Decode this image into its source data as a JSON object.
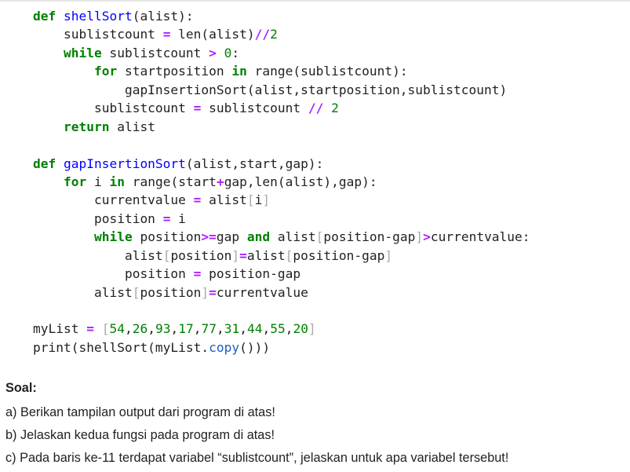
{
  "code": {
    "language": "python",
    "lines": [
      [
        {
          "t": "def ",
          "c": "kw"
        },
        {
          "t": "shellSort",
          "c": "fn"
        },
        {
          "t": "(alist):",
          "c": ""
        }
      ],
      [
        {
          "t": "    sublistcount ",
          "c": ""
        },
        {
          "t": "=",
          "c": "op"
        },
        {
          "t": " len(alist)",
          "c": ""
        },
        {
          "t": "//",
          "c": "op"
        },
        {
          "t": "2",
          "c": "num"
        }
      ],
      [
        {
          "t": "    ",
          "c": ""
        },
        {
          "t": "while",
          "c": "kw"
        },
        {
          "t": " sublistcount ",
          "c": ""
        },
        {
          "t": ">",
          "c": "op"
        },
        {
          "t": " ",
          "c": ""
        },
        {
          "t": "0",
          "c": "num"
        },
        {
          "t": ":",
          "c": ""
        }
      ],
      [
        {
          "t": "        ",
          "c": ""
        },
        {
          "t": "for",
          "c": "kw"
        },
        {
          "t": " startposition ",
          "c": ""
        },
        {
          "t": "in",
          "c": "kw"
        },
        {
          "t": " range(sublistcount):",
          "c": ""
        }
      ],
      [
        {
          "t": "            gapInsertionSort(alist,startposition,sublistcount)",
          "c": ""
        }
      ],
      [
        {
          "t": "        sublistcount ",
          "c": ""
        },
        {
          "t": "=",
          "c": "op"
        },
        {
          "t": " sublistcount ",
          "c": ""
        },
        {
          "t": "//",
          "c": "op"
        },
        {
          "t": " ",
          "c": ""
        },
        {
          "t": "2",
          "c": "num"
        }
      ],
      [
        {
          "t": "    ",
          "c": ""
        },
        {
          "t": "return",
          "c": "kw"
        },
        {
          "t": " alist",
          "c": ""
        }
      ],
      [],
      [
        {
          "t": "def ",
          "c": "kw"
        },
        {
          "t": "gapInsertionSort",
          "c": "fn"
        },
        {
          "t": "(alist,start,gap):",
          "c": ""
        }
      ],
      [
        {
          "t": "    ",
          "c": ""
        },
        {
          "t": "for",
          "c": "kw"
        },
        {
          "t": " i ",
          "c": ""
        },
        {
          "t": "in",
          "c": "kw"
        },
        {
          "t": " range(start",
          "c": ""
        },
        {
          "t": "+",
          "c": "op"
        },
        {
          "t": "gap,len(alist),gap):",
          "c": ""
        }
      ],
      [
        {
          "t": "        currentvalue ",
          "c": ""
        },
        {
          "t": "=",
          "c": "op"
        },
        {
          "t": " alist",
          "c": ""
        },
        {
          "t": "[",
          "c": "br"
        },
        {
          "t": "i",
          "c": ""
        },
        {
          "t": "]",
          "c": "br"
        }
      ],
      [
        {
          "t": "        position ",
          "c": ""
        },
        {
          "t": "=",
          "c": "op"
        },
        {
          "t": " i",
          "c": ""
        }
      ],
      [
        {
          "t": "        ",
          "c": ""
        },
        {
          "t": "while",
          "c": "kw"
        },
        {
          "t": " position",
          "c": ""
        },
        {
          "t": ">=",
          "c": "op"
        },
        {
          "t": "gap ",
          "c": ""
        },
        {
          "t": "and",
          "c": "kw"
        },
        {
          "t": " alist",
          "c": ""
        },
        {
          "t": "[",
          "c": "br"
        },
        {
          "t": "position-gap",
          "c": ""
        },
        {
          "t": "]",
          "c": "br"
        },
        {
          "t": ">",
          "c": "op"
        },
        {
          "t": "currentvalue:",
          "c": ""
        }
      ],
      [
        {
          "t": "            alist",
          "c": ""
        },
        {
          "t": "[",
          "c": "br"
        },
        {
          "t": "position",
          "c": ""
        },
        {
          "t": "]",
          "c": "br"
        },
        {
          "t": "=",
          "c": "op"
        },
        {
          "t": "alist",
          "c": ""
        },
        {
          "t": "[",
          "c": "br"
        },
        {
          "t": "position-gap",
          "c": ""
        },
        {
          "t": "]",
          "c": "br"
        }
      ],
      [
        {
          "t": "            position ",
          "c": ""
        },
        {
          "t": "=",
          "c": "op"
        },
        {
          "t": " position-gap",
          "c": ""
        }
      ],
      [
        {
          "t": "        alist",
          "c": ""
        },
        {
          "t": "[",
          "c": "br"
        },
        {
          "t": "position",
          "c": ""
        },
        {
          "t": "]",
          "c": "br"
        },
        {
          "t": "=",
          "c": "op"
        },
        {
          "t": "currentvalue",
          "c": ""
        }
      ],
      [],
      [
        {
          "t": "myList ",
          "c": ""
        },
        {
          "t": "=",
          "c": "op"
        },
        {
          "t": " ",
          "c": ""
        },
        {
          "t": "[",
          "c": "br"
        },
        {
          "t": "54",
          "c": "num"
        },
        {
          "t": ",",
          "c": ""
        },
        {
          "t": "26",
          "c": "num"
        },
        {
          "t": ",",
          "c": ""
        },
        {
          "t": "93",
          "c": "num"
        },
        {
          "t": ",",
          "c": ""
        },
        {
          "t": "17",
          "c": "num"
        },
        {
          "t": ",",
          "c": ""
        },
        {
          "t": "77",
          "c": "num"
        },
        {
          "t": ",",
          "c": ""
        },
        {
          "t": "31",
          "c": "num"
        },
        {
          "t": ",",
          "c": ""
        },
        {
          "t": "44",
          "c": "num"
        },
        {
          "t": ",",
          "c": ""
        },
        {
          "t": "55",
          "c": "num"
        },
        {
          "t": ",",
          "c": ""
        },
        {
          "t": "20",
          "c": "num"
        },
        {
          "t": "]",
          "c": "br"
        }
      ],
      [
        {
          "t": "print(shellSort(myList.",
          "c": ""
        },
        {
          "t": "copy",
          "c": "meth"
        },
        {
          "t": "()))",
          "c": ""
        }
      ]
    ]
  },
  "questions": {
    "title": "Soal:",
    "items": [
      "a) Berikan tampilan output dari program di atas!",
      "b) Jelaskan kedua fungsi pada program di atas!",
      "c) Pada baris ke-11 terdapat variabel “sublistcount”, jelaskan untuk apa variabel tersebut!"
    ]
  },
  "colors": {
    "keyword": "#008000",
    "function_name": "#0000ff",
    "operator": "#aa22ff",
    "number": "#008000",
    "bracket": "#aaaaaa",
    "text": "#222222"
  }
}
